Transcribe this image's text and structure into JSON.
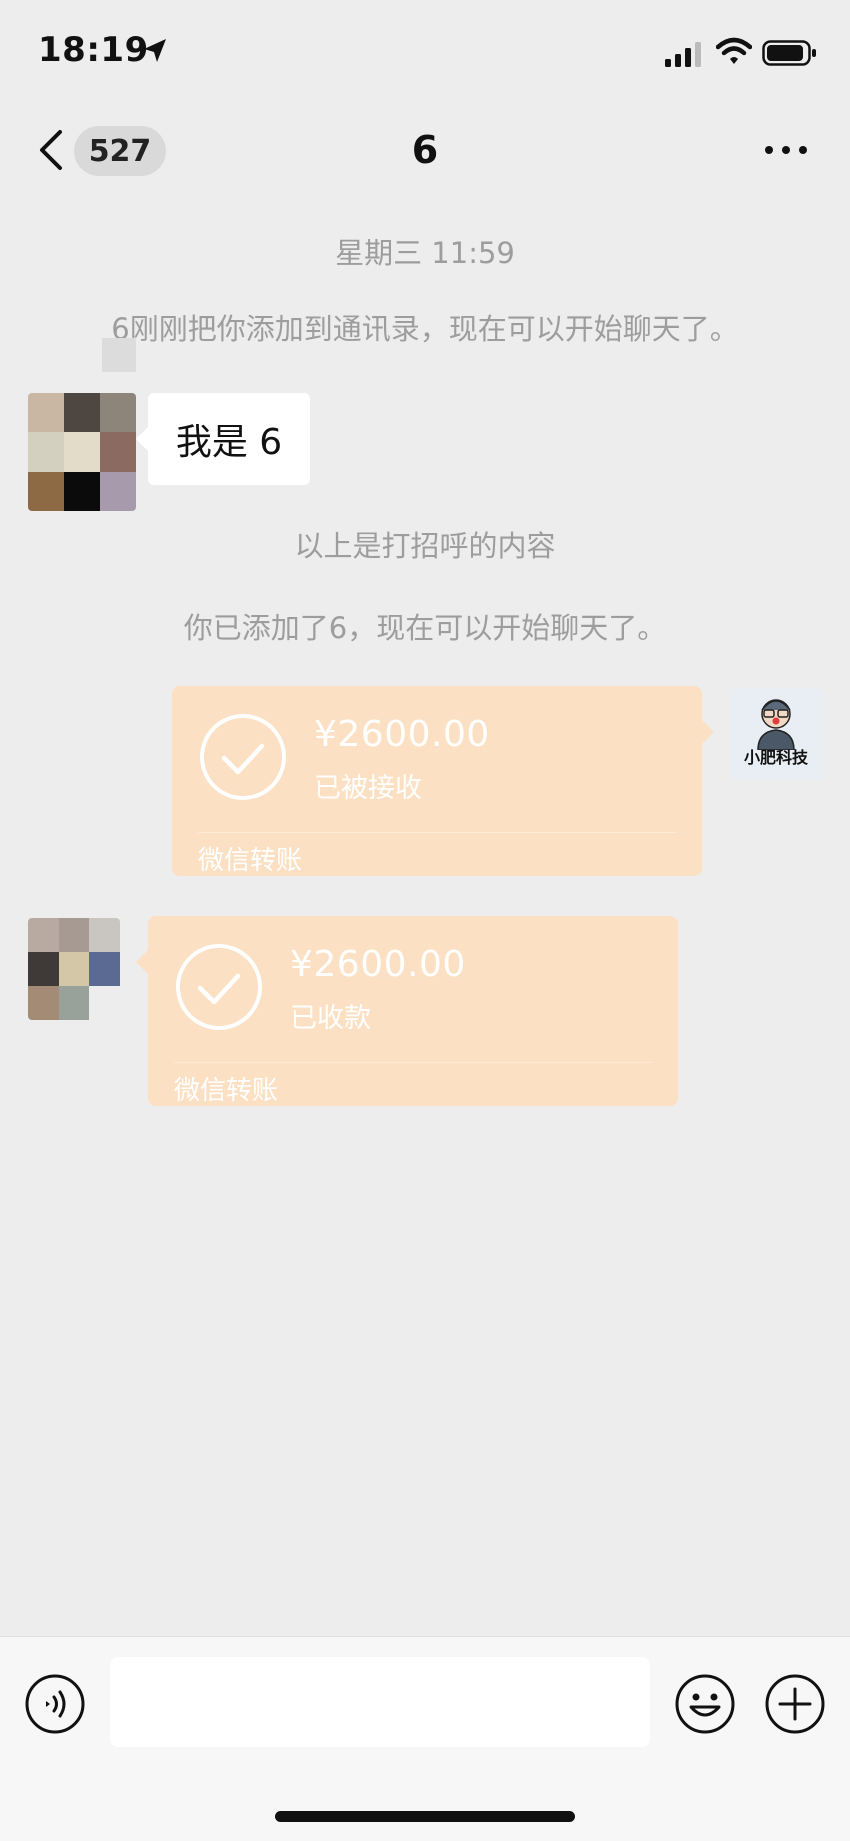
{
  "status_bar": {
    "time": "18:19",
    "icons": [
      "location-arrow-icon",
      "signal-icon",
      "wifi-icon",
      "battery-icon"
    ]
  },
  "nav": {
    "back_icon": "chevron-left-icon",
    "unread_count": "527",
    "title": "6",
    "more_icon": "ellipsis-icon"
  },
  "messages": {
    "timestamp": "星期三 11:59",
    "added_notice": "6刚刚把你添加到通讯录，现在可以开始聊天了。",
    "greeting_text": "我是 6",
    "greeting_footer": "以上是打招呼的内容",
    "you_added_notice": "你已添加了6，现在可以开始聊天了。",
    "self_avatar_label": "小肥科技",
    "transfer_sent": {
      "amount": "¥2600.00",
      "status": "已被接收",
      "footer": "微信转账"
    },
    "transfer_received": {
      "amount": "¥2600.00",
      "status": "已收款",
      "footer": "微信转账"
    }
  },
  "input_bar": {
    "placeholder": "",
    "icons": [
      "voice-icon",
      "emoji-icon",
      "plus-icon"
    ]
  },
  "colors": {
    "background": "#ededed",
    "transfer_card": "#fce0c3",
    "system_text": "#9d9d9d",
    "bubble": "#ffffff"
  }
}
